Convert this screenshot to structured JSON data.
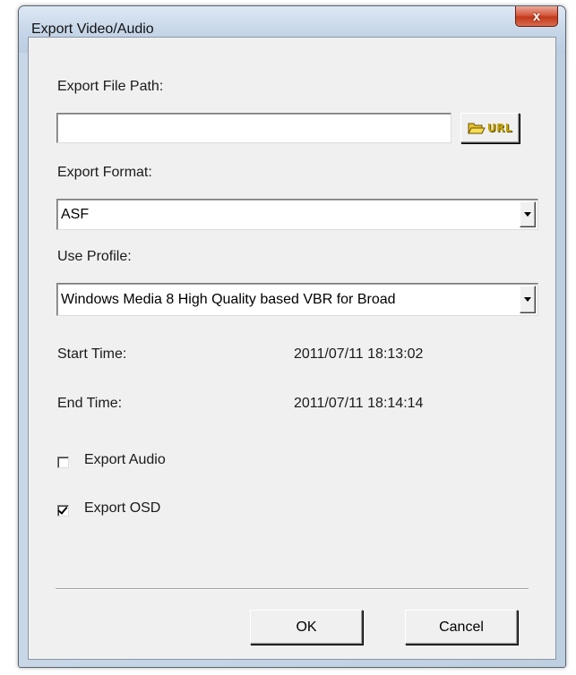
{
  "window": {
    "title": "Export Video/Audio",
    "close_label": "x"
  },
  "export_path": {
    "label": "Export File Path:",
    "value": "",
    "url_button_label": "URL"
  },
  "export_format": {
    "label": "Export Format:",
    "selected": "ASF"
  },
  "profile": {
    "label": "Use Profile:",
    "selected": "Windows Media 8 High Quality based VBR for Broad"
  },
  "times": {
    "start_label": "Start Time:",
    "start_value": "2011/07/11 18:13:02",
    "end_label": "End Time:",
    "end_value": "2011/07/11 18:14:14"
  },
  "options": {
    "export_audio_label": "Export Audio",
    "export_audio_checked": false,
    "export_osd_label": "Export OSD",
    "export_osd_checked": true
  },
  "buttons": {
    "ok_label": "OK",
    "cancel_label": "Cancel"
  }
}
